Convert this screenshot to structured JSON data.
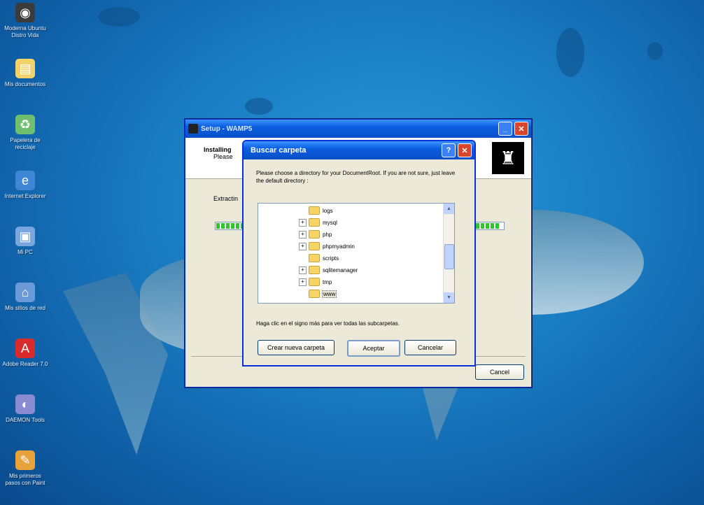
{
  "desktop": {
    "icons": [
      {
        "label": "Moderna Ubuntu Distro Vida",
        "icon": "ubuntu-icon",
        "color": "#3b3b3b"
      },
      {
        "label": "Mis documentos",
        "icon": "my-documents-icon",
        "color": "#f2d36b"
      },
      {
        "label": "Papelera de reciclaje",
        "icon": "recycle-bin-icon",
        "color": "#6fbf6f"
      },
      {
        "label": "Internet Explorer",
        "icon": "internet-explorer-icon",
        "color": "#3f86d6"
      },
      {
        "label": "Mi PC",
        "icon": "my-computer-icon",
        "color": "#7aa6e0"
      },
      {
        "label": "Mis sitios de red",
        "icon": "network-places-icon",
        "color": "#6a9ad8"
      },
      {
        "label": "Adobe Reader 7.0",
        "icon": "adobe-reader-icon",
        "color": "#d92b2b"
      },
      {
        "label": "DAEMON Tools",
        "icon": "daemon-tools-icon",
        "color": "#8a8ad0"
      },
      {
        "label": "Mis primeros pasos con Paint",
        "icon": "paint-icon",
        "color": "#e8a23c"
      }
    ]
  },
  "setup_window": {
    "title": "Setup - WAMP5",
    "header_title": "Installing",
    "header_sub": "Please",
    "extract_label": "Extractin",
    "cancel_label": "Cancel"
  },
  "browse_dialog": {
    "title": "Buscar carpeta",
    "message": "Please choose a directory for your DocumentRoot. If you are not sure, just leave the default directory :",
    "tree": [
      {
        "name": "logs",
        "expandable": false
      },
      {
        "name": "mysql",
        "expandable": true
      },
      {
        "name": "php",
        "expandable": true
      },
      {
        "name": "phpmyadmin",
        "expandable": true
      },
      {
        "name": "scripts",
        "expandable": false
      },
      {
        "name": "sqlitemanager",
        "expandable": true
      },
      {
        "name": "tmp",
        "expandable": true
      },
      {
        "name": "www",
        "expandable": false,
        "selected": true
      }
    ],
    "hint": "Haga clic en el signo más para ver todas las subcarpetas.",
    "new_folder_label": "Crear nueva carpeta",
    "ok_label": "Aceptar",
    "cancel_label": "Cancelar"
  },
  "colors": {
    "xp_title_blue": "#0a5ee0",
    "xp_face": "#ece9d8",
    "progress_green": "#2ec52e"
  }
}
